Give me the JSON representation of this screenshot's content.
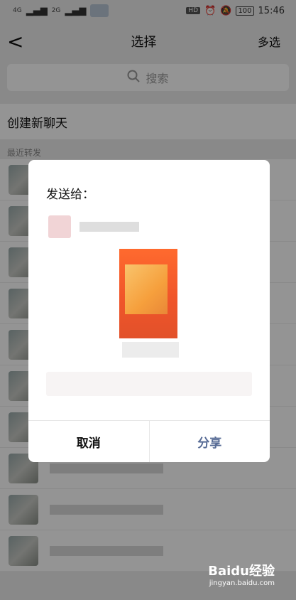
{
  "status": {
    "signal1": "4G",
    "signal2": "2G",
    "battery": "100",
    "hd": "HD",
    "time": "15:46"
  },
  "nav": {
    "back": "<",
    "title": "选择",
    "multi": "多选"
  },
  "search": {
    "placeholder": "搜索"
  },
  "new_chat": "创建新聊天",
  "recent_label": "最近转发",
  "dialog": {
    "title": "发送给：",
    "cancel": "取消",
    "share": "分享"
  },
  "watermark": {
    "logo": "Baidu经验",
    "url": "jingyan.baidu.com"
  }
}
